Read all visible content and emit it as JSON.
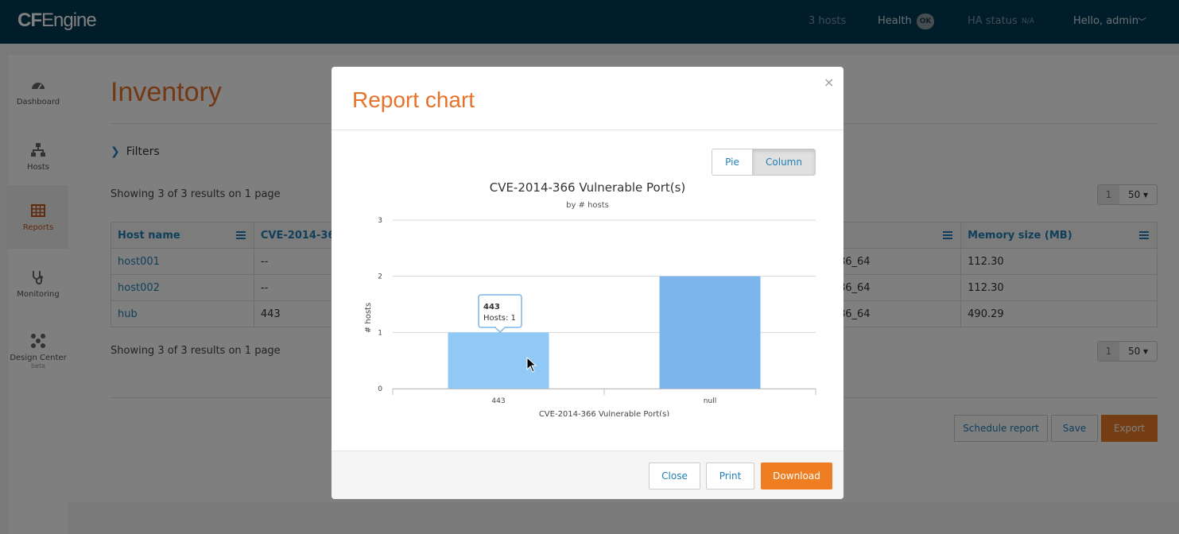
{
  "topbar": {
    "brand_bold": "CF",
    "brand_rest": "Engine",
    "hosts": "3 hosts",
    "health": "Health",
    "health_badge": "OK",
    "ha_status": "HA status",
    "ha_value": "N/A",
    "user": "Hello, admin"
  },
  "sidebar": {
    "items": [
      {
        "label": "Dashboard",
        "icon": "dashboard-icon"
      },
      {
        "label": "Hosts",
        "icon": "hosts-icon"
      },
      {
        "label": "Reports",
        "icon": "table-icon"
      },
      {
        "label": "Monitoring",
        "icon": "stethoscope-icon"
      },
      {
        "label": "Design Center",
        "sub": "beta",
        "icon": "design-icon"
      }
    ]
  },
  "main": {
    "title": "Inventory",
    "filters": "Filters",
    "showing_top": "Showing 3 of 3 results on 1 page",
    "showing_bottom": "Showing 3 of 3 results on 1 page",
    "pager_page": "1",
    "pager_per": "50 ▾",
    "columns": [
      "Host name",
      "CVE-2014-366",
      "",
      "Memory size (MB)"
    ],
    "rows": [
      [
        "host001",
        "--",
        "x86_64",
        "112.30"
      ],
      [
        "host002",
        "--",
        "x86_64",
        "112.30"
      ],
      [
        "hub",
        "443",
        "x86_64",
        "490.29"
      ]
    ],
    "schedule_report": "Schedule report",
    "save": "Save",
    "export": "Export"
  },
  "modal": {
    "title": "Report chart",
    "close_x": "×",
    "pie": "Pie",
    "column": "Column",
    "close": "Close",
    "print": "Print",
    "download": "Download",
    "tooltip_title": "443",
    "tooltip_value": "Hosts: 1"
  },
  "chart_data": {
    "type": "bar",
    "title": "CVE-2014-366 Vulnerable Port(s)",
    "subtitle": "by # hosts",
    "xlabel": "CVE-2014-366 Vulnerable Port(s)",
    "ylabel": "# hosts",
    "categories": [
      "443",
      "null"
    ],
    "values": [
      1,
      2
    ],
    "ylim": [
      0,
      3
    ],
    "yticks": [
      "0",
      "1",
      "2",
      "3"
    ],
    "colors": [
      "#90c8f6",
      "#7cb5ec"
    ],
    "grid": true
  }
}
